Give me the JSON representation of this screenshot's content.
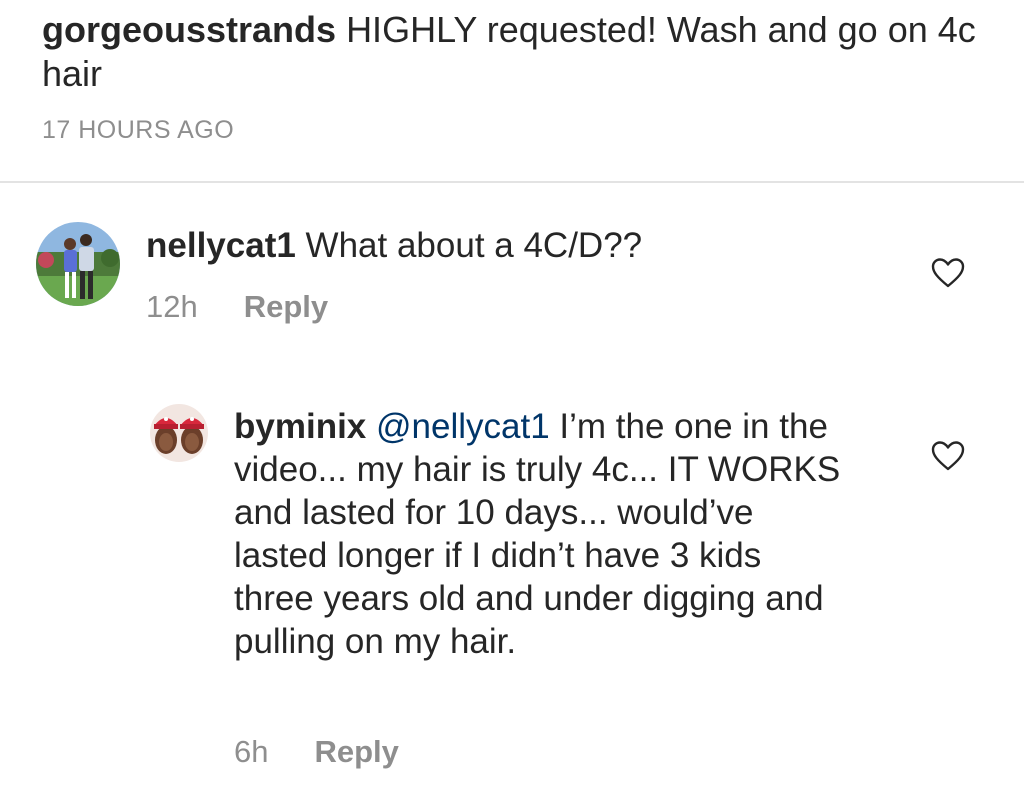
{
  "post": {
    "username": "gorgeousstrands",
    "caption": "HIGHLY requested! Wash and go on 4c hair",
    "timestamp": "17 HOURS AGO"
  },
  "comments": [
    {
      "username": "nellycat1",
      "text": "What about a 4C/D??",
      "time": "12h",
      "reply_label": "Reply",
      "like_icon": "heart-outline-icon"
    },
    {
      "username": "byminix",
      "mention": "@nellycat1",
      "text": "I’m the one in the video... my hair is truly 4c... IT WORKS and lasted for 10 days... would’ve lasted longer if I didn’t have 3 kids three years old and under digging and pulling on my hair.",
      "time": "6h",
      "reply_label": "Reply",
      "like_icon": "heart-outline-icon"
    }
  ],
  "colors": {
    "text": "#262626",
    "secondary": "#8e8e8e",
    "mention": "#003569",
    "divider": "#e3e3e3"
  }
}
